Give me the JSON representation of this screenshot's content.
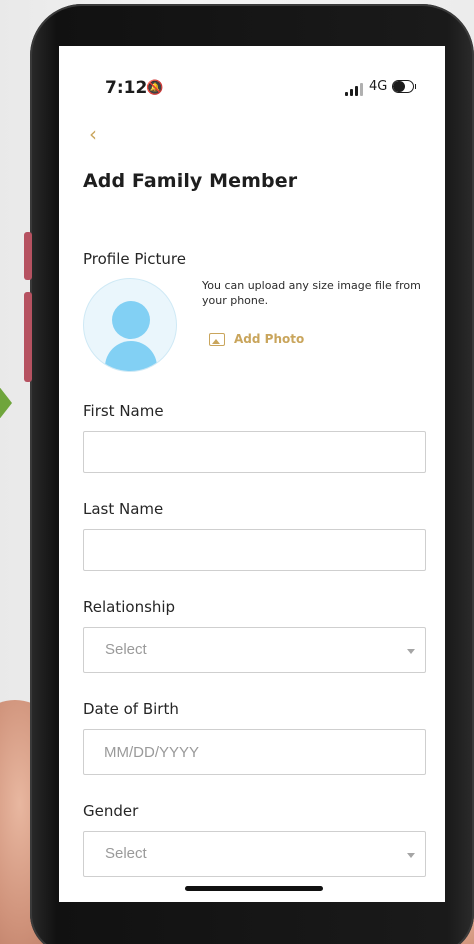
{
  "status_bar": {
    "time": "7:12",
    "network": "4G",
    "icons": [
      "bell-muted-icon",
      "signal-bars-icon",
      "battery-icon"
    ]
  },
  "header": {
    "back_icon": "chevron-left-icon",
    "back_glyph": "‹",
    "title": "Add Family Member"
  },
  "profile": {
    "label": "Profile Picture",
    "hint": "You can upload any size image file from your phone.",
    "add_photo_label": "Add Photo",
    "avatar_icon": "person-placeholder-icon",
    "photo_icon": "image-icon"
  },
  "form": {
    "first_name": {
      "label": "First Name",
      "value": "",
      "placeholder": ""
    },
    "last_name": {
      "label": "Last Name",
      "value": "",
      "placeholder": ""
    },
    "relationship": {
      "label": "Relationship",
      "selected": "Select"
    },
    "date_of_birth": {
      "label": "Date of Birth",
      "value": "",
      "placeholder": "MM/DD/YYYY"
    },
    "gender": {
      "label": "Gender",
      "selected": "Select"
    }
  },
  "colors": {
    "accent": "#c9a55c",
    "avatar_fill": "#82d0f4",
    "avatar_bg": "#eaf6fc",
    "field_border": "#cfcfcf",
    "phone_side_button": "#b65261",
    "decor_arrow": "#6fa53c"
  }
}
